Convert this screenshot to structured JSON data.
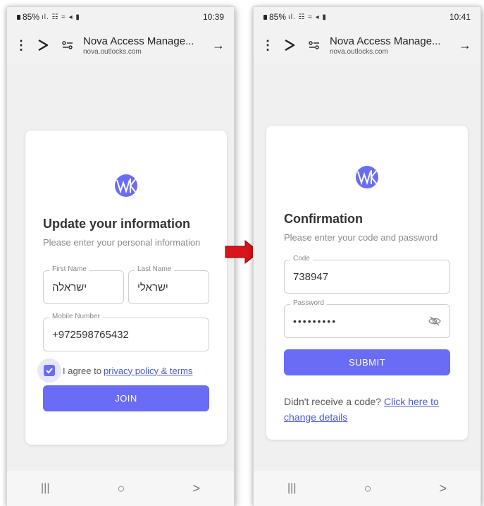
{
  "colors": {
    "accent": "#6a6cf6",
    "arrow": "#d8141c",
    "link": "#4b5ad1"
  },
  "phone1": {
    "status": {
      "battery": "85%",
      "glyphs": "ıl. ☷ ≈ ◂ ▮",
      "time": "10:39"
    },
    "browser": {
      "title": "Nova Access Manage...",
      "url": "nova.outlocks.com"
    },
    "card": {
      "title": "Update your information",
      "subtitle": "Please enter your personal information",
      "first_name": {
        "label": "First Name",
        "value": "ישראלה"
      },
      "last_name": {
        "label": "Last Name",
        "value": "ישראלי"
      },
      "mobile": {
        "label": "Mobile Number",
        "value": "+972598765432"
      },
      "agree": {
        "text": "I agree to ",
        "link": "privacy policy & terms",
        "checked": true
      },
      "button": "JOIN"
    }
  },
  "phone2": {
    "status": {
      "battery": "85%",
      "glyphs": "ıl. ☷ ≈ ◂ ▮",
      "time": "10:41"
    },
    "browser": {
      "title": "Nova Access Manage...",
      "url": "nova.outlocks.com"
    },
    "card": {
      "title": "Confirmation",
      "subtitle": "Please enter your code and password",
      "code": {
        "label": "Code",
        "value": "738947"
      },
      "password": {
        "label": "Password",
        "value": "•••••••••"
      },
      "button": "SUBMIT",
      "resend_text": "Didn't receive a code? ",
      "resend_link": "Click here to change details"
    }
  },
  "nav": {
    "recents": "|||",
    "home": "○",
    "back": ">"
  }
}
